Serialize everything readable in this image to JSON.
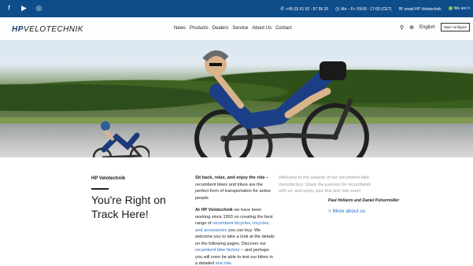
{
  "topbar": {
    "social": [
      "f",
      "▶",
      "◎"
    ],
    "phone": "+49 (0) 61 92 - 97 99 20",
    "hours": "Mo – Fr: 09:00 - 17:00 (CET)",
    "email": "email HP Velotechnik",
    "status": "We are h"
  },
  "nav": {
    "logo_a": "HP",
    "logo_b": "VELOTECHNIK",
    "menu": [
      "News",
      "Products",
      "Dealers",
      "Service",
      "About Us",
      "Contact"
    ],
    "language": "English",
    "cta": "Start configure"
  },
  "content": {
    "kicker": "HP Velotechnik",
    "title": "You're Right on Track Here!",
    "lead_bold": "Sit back, relax, and enjoy the ride –",
    "lead_rest": " recumbent bikes and trikes are the perfect form of transportation for active people.",
    "p2_bold": "At HP Velotechnik",
    "p2_a": " we have been working since 1993 on creating the best range of ",
    "p2_link1": "recumbent bicycles, tricycles, and accessories",
    "p2_b": " you can buy. We welcome you to take a look at the details on the following pages. Discover our ",
    "p2_link2": "recumbent bike factory",
    "p2_c": " – and perhaps you will soon be able to test our bikes in a detailed ",
    "p2_link3": "test ride",
    "p2_d": ".",
    "quote": "Welcome to the website of our recumbent bike manufactory. Share the passion for recumbents with us, and enjoy your first test ride soon!",
    "authors": "Paul Hollants and Daniel Pulvermüller",
    "more": "> More about us"
  },
  "colors": {
    "topbar": "#0f4c8a",
    "link": "#1f6fc2"
  }
}
